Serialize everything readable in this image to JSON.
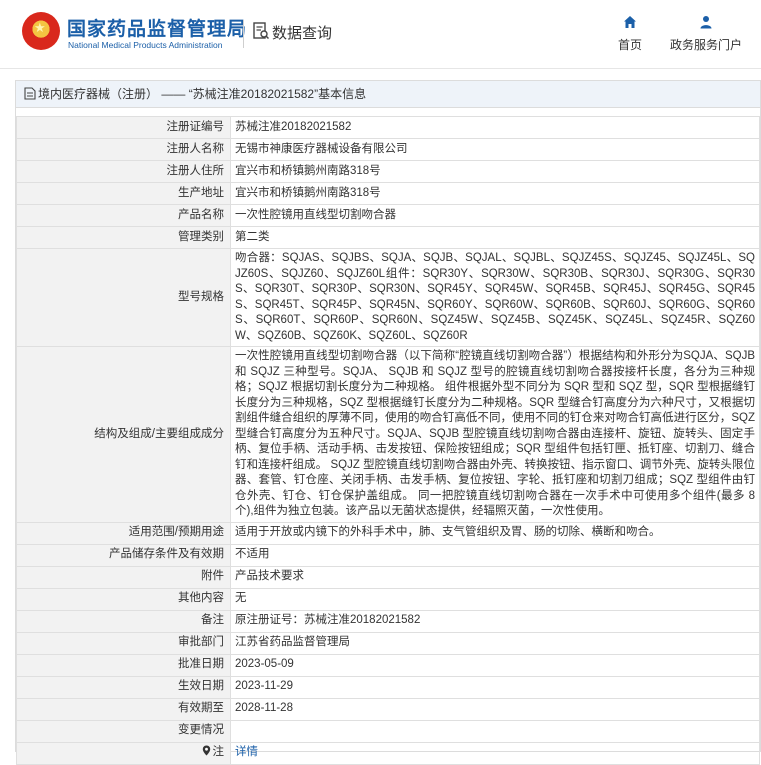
{
  "header": {
    "brand_cn": "国家药品监督管理局",
    "brand_en": "National Medical Products Administration",
    "query_label": "数据查询",
    "nav": [
      {
        "label": "首页",
        "icon": "home-icon"
      },
      {
        "label": "政务服务门户",
        "icon": "user-icon"
      }
    ]
  },
  "panel": {
    "title_prefix": "境内医疗器械（注册）",
    "title_sep": " —— ",
    "title_main": "“苏械注准20182021582”基本信息"
  },
  "fields": [
    {
      "key": "注册证编号",
      "value": "苏械注准20182021582"
    },
    {
      "key": "注册人名称",
      "value": "无锡市神康医疗器械设备有限公司"
    },
    {
      "key": "注册人住所",
      "value": "宜兴市和桥镇鹅州南路318号"
    },
    {
      "key": "生产地址",
      "value": "宜兴市和桥镇鹅州南路318号"
    },
    {
      "key": "产品名称",
      "value": "一次性腔镜用直线型切割吻合器"
    },
    {
      "key": "管理类别",
      "value": "第二类"
    },
    {
      "key": "型号规格",
      "value": "吻合器：SQJAS、SQJBS、SQJA、SQJB、SQJAL、SQJBL、SQJZ45S、SQJZ45、SQJZ45L、SQJZ60S、SQJZ60、SQJZ60L组件：SQR30Y、SQR30W、SQR30B、SQR30J、SQR30G、SQR30S、SQR30T、SQR30P、SQR30N、SQR45Y、SQR45W、SQR45B、SQR45J、SQR45G、SQR45S、SQR45T、SQR45P、SQR45N、SQR60Y、SQR60W、SQR60B、SQR60J、SQR60G、SQR60S、SQR60T、SQR60P、SQR60N、SQZ45W、SQZ45B、SQZ45K、SQZ45L、SQZ45R、SQZ60W、SQZ60B、SQZ60K、SQZ60L、SQZ60R"
    },
    {
      "key": "结构及组成/主要组成成分",
      "value": "一次性腔镜用直线型切割吻合器（以下简称“腔镜直线切割吻合器”）根据结构和外形分为SQJA、SQJB 和 SQJZ 三种型号。SQJA、 SQJB 和 SQJZ 型号的腔镜直线切割吻合器按接杆长度，各分为三种规格；SQJZ 根据切割长度分为二种规格。 组件根据外型不同分为 SQR 型和 SQZ 型，SQR 型根据缝钉长度分为三种规格，SQZ 型根据缝钉长度分为二种规格。SQR 型缝合钉高度分为六种尺寸，又根据切割组件缝合组织的厚薄不同，使用的吻合钉高低不同，使用不同的钉仓来对吻合钉高低进行区分，SQZ 型缝合钉高度分为五种尺寸。SQJA、SQJB 型腔镜直线切割吻合器由连接杆、旋钮、旋转头、固定手柄、复位手柄、活动手柄、击发按钮、保险按钮组成；SQR 型组件包括钉匣、抵钉座、切割刀、缝合钉和连接杆组成。 SQJZ 型腔镜直线切割吻合器由外壳、转换按钮、指示窗口、调节外壳、旋转头限位器、套管、钉仓座、关闭手柄、击发手柄、复位按钮、字轮、抵钉座和切割刀组成；SQZ 型组件由钉仓外壳、钉仓、钉仓保护盖组成。 同一把腔镜直线切割吻合器在一次手术中可使用多个组件(最多 8 个),组件为独立包装。该产品以无菌状态提供，经辐照灭菌，一次性使用。"
    },
    {
      "key": "适用范围/预期用途",
      "value": "适用于开放或内镜下的外科手术中，肺、支气管组织及胃、肠的切除、横断和吻合。"
    },
    {
      "key": "产品储存条件及有效期",
      "value": "不适用"
    },
    {
      "key": "附件",
      "value": "产品技术要求"
    },
    {
      "key": "其他内容",
      "value": "无"
    },
    {
      "key": "备注",
      "value": "原注册证号：苏械注准20182021582"
    },
    {
      "key": "审批部门",
      "value": "江苏省药品监督管理局"
    },
    {
      "key": "批准日期",
      "value": "2023-05-09"
    },
    {
      "key": "生效日期",
      "value": "2023-11-29"
    },
    {
      "key": "有效期至",
      "value": "2028-11-28"
    },
    {
      "key": "变更情况",
      "value": ""
    }
  ],
  "note_row": {
    "key": "注",
    "value": "详情",
    "icon": "location-pin-icon"
  }
}
